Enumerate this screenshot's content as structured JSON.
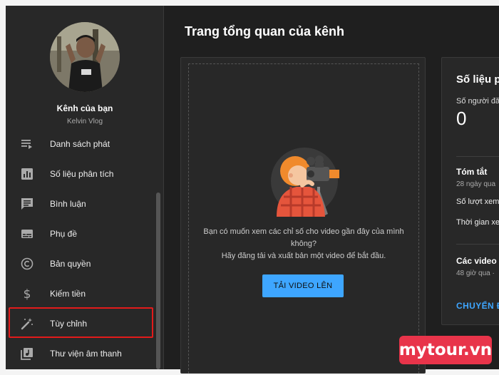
{
  "sidebar": {
    "channel_name": "Kênh của bạn",
    "channel_handle": "Kelvin Vlog",
    "items": [
      {
        "label": "Danh sách phát",
        "icon": "playlist-icon"
      },
      {
        "label": "Số liệu phân tích",
        "icon": "analytics-icon"
      },
      {
        "label": "Bình luận",
        "icon": "comments-icon"
      },
      {
        "label": "Phụ đề",
        "icon": "subtitles-icon"
      },
      {
        "label": "Bản quyền",
        "icon": "copyright-icon"
      },
      {
        "label": "Kiếm tiền",
        "icon": "dollar-icon"
      },
      {
        "label": "Tùy chỉnh",
        "icon": "magic-wand-icon",
        "highlighted": true
      },
      {
        "label": "Thư viện âm thanh",
        "icon": "audio-library-icon"
      }
    ]
  },
  "main": {
    "title": "Trang tổng quan của kênh",
    "upload_card": {
      "line1": "Bạn có muốn xem các chỉ số cho video gần đây của mình",
      "line2": "không?",
      "line3": "Hãy đăng tải và xuất bản một video để bắt đầu.",
      "button": "TẢI VIDEO LÊN"
    },
    "analytics_card": {
      "title": "Số liệu p",
      "subscribers_label": "Số người đă",
      "subscribers_value": "0",
      "summary_title": "Tóm tắt",
      "summary_period": "28 ngày qua",
      "views_label": "Số lượt xem",
      "watch_time_label": "Thời gian xem",
      "videos_title": "Các video",
      "videos_period": "48 giờ qua ·",
      "link": "CHUYỂN Đ"
    }
  },
  "watermark": "mytour.vn",
  "colors": {
    "accent": "#3ea6ff",
    "highlight_border": "#e31b1b",
    "watermark_bg": "#e8344a",
    "background": "#1f1f1f",
    "panel": "#282828"
  }
}
